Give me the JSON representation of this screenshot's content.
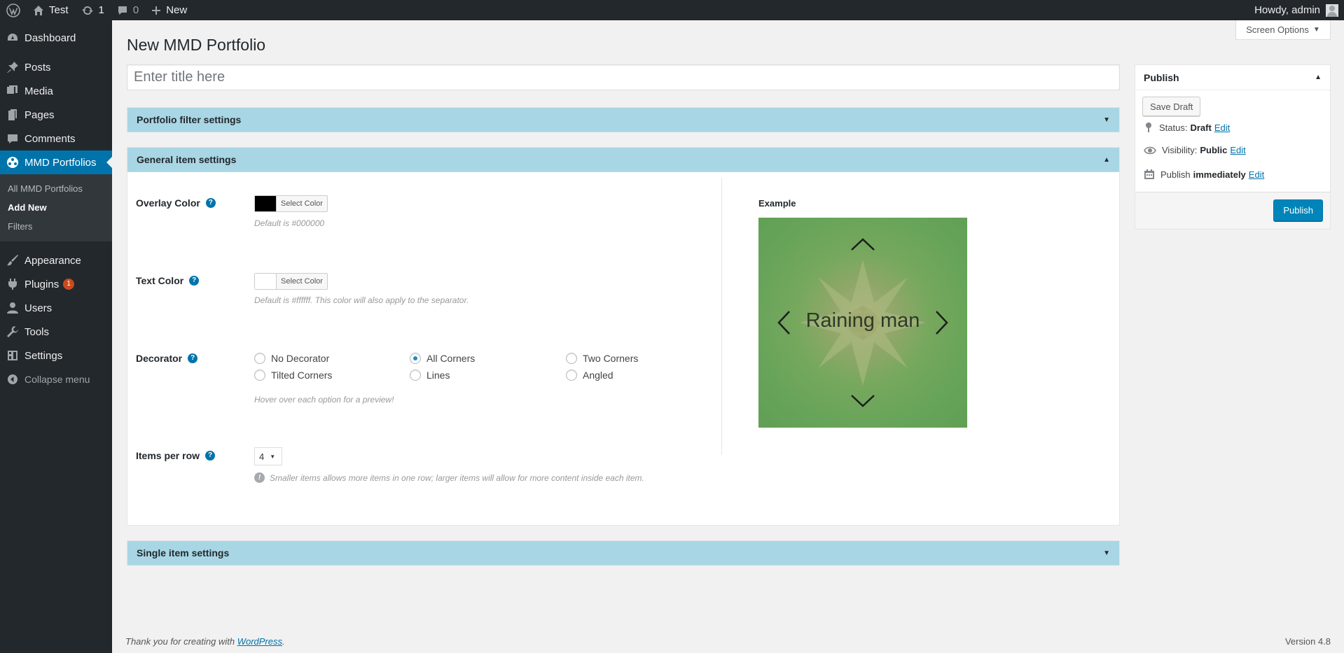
{
  "adminbar": {
    "site_name": "Test",
    "updates_count": "1",
    "comments_count": "0",
    "new_label": "New",
    "howdy": "Howdy, admin"
  },
  "sidebar": {
    "items": [
      {
        "label": "Dashboard",
        "icon": "dashboard-icon"
      },
      {
        "label": "Posts",
        "icon": "pin-icon"
      },
      {
        "label": "Media",
        "icon": "media-icon"
      },
      {
        "label": "Pages",
        "icon": "pages-icon"
      },
      {
        "label": "Comments",
        "icon": "comment-icon"
      },
      {
        "label": "MMD Portfolios",
        "icon": "portfolio-icon"
      }
    ],
    "submenu": [
      "All MMD Portfolios",
      "Add New",
      "Filters"
    ],
    "items2": [
      {
        "label": "Appearance",
        "icon": "brush-icon"
      },
      {
        "label": "Plugins",
        "icon": "plugin-icon",
        "badge": "1"
      },
      {
        "label": "Users",
        "icon": "users-icon"
      },
      {
        "label": "Tools",
        "icon": "wrench-icon"
      },
      {
        "label": "Settings",
        "icon": "settings-icon"
      }
    ],
    "collapse": "Collapse menu"
  },
  "page": {
    "title": "New MMD Portfolio",
    "screen_options": "Screen Options",
    "title_placeholder": "Enter title here"
  },
  "portfolio_filter": {
    "header": "Portfolio filter settings"
  },
  "general": {
    "header": "General item settings",
    "overlay_label": "Overlay Color",
    "overlay_color": "#000000",
    "overlay_btn": "Select Color",
    "overlay_desc": "Default is #000000",
    "text_label": "Text Color",
    "text_color": "#ffffff",
    "text_btn": "Select Color",
    "text_desc": "Default is #ffffff. This color will also apply to the separator.",
    "decorator_label": "Decorator",
    "decorators": [
      "No Decorator",
      "All Corners",
      "Two Corners",
      "Tilted Corners",
      "Lines",
      "Angled"
    ],
    "decorator_selected": "All Corners",
    "decorator_hint": "Hover over each option for a preview!",
    "items_label": "Items per row",
    "items_value": "4",
    "items_hint": "Smaller items allows more items in one row; larger items will allow for more content inside each item.",
    "example_label": "Example",
    "example_title": "Raining man"
  },
  "single": {
    "header": "Single item settings"
  },
  "publish": {
    "header": "Publish",
    "save_draft": "Save Draft",
    "status_label": "Status:",
    "status_value": "Draft",
    "visibility_label": "Visibility:",
    "visibility_value": "Public",
    "publish_label": "Publish",
    "publish_value": "immediately",
    "edit": "Edit",
    "publish_btn": "Publish"
  },
  "footer": {
    "thanks": "Thank you for creating with",
    "wp_link": "WordPress",
    "version": "Version 4.8"
  }
}
